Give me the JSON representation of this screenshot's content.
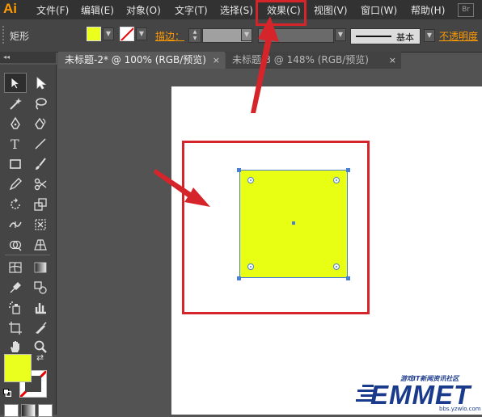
{
  "app": {
    "logo": "Ai",
    "badge": "Br"
  },
  "menu": [
    {
      "label": "文件(F)"
    },
    {
      "label": "编辑(E)"
    },
    {
      "label": "对象(O)"
    },
    {
      "label": "文字(T)"
    },
    {
      "label": "选择(S)"
    },
    {
      "label": "效果(C)"
    },
    {
      "label": "视图(V)"
    },
    {
      "label": "窗口(W)"
    },
    {
      "label": "帮助(H)"
    }
  ],
  "control_bar": {
    "tool_name": "矩形",
    "fill_color": "#ebff1e",
    "stroke_label": "描边：",
    "brush_name": "基本",
    "opacity_label": "不透明度"
  },
  "tabs": [
    {
      "label": "未标题-2* @ 100% (RGB/预览)",
      "close": "×",
      "active": true
    },
    {
      "label": "未标题-3 @ 148% (RGB/预览)",
      "close": "×",
      "active": false
    }
  ],
  "toolbar": {
    "collapse_label": "◂◂"
  },
  "canvas": {
    "shape_fill": "#e8ff14",
    "highlight_color": "#d6252a"
  },
  "watermark": {
    "tagline": "游戏IT新闻资讯社区",
    "logo": "EMMET",
    "url": "bbs.yzwlo.com"
  }
}
